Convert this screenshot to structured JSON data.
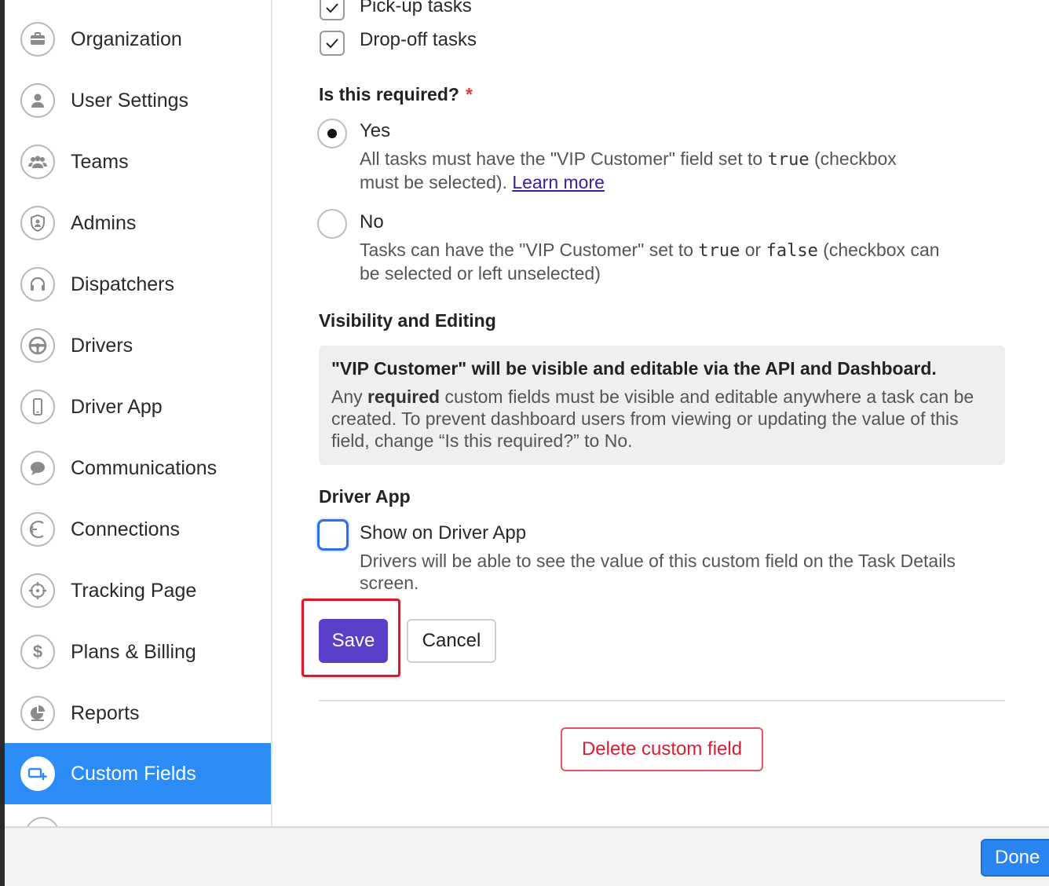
{
  "sidebar": {
    "items": [
      {
        "label": "Organization",
        "icon": "briefcase-icon"
      },
      {
        "label": "User Settings",
        "icon": "user-icon"
      },
      {
        "label": "Teams",
        "icon": "team-icon"
      },
      {
        "label": "Admins",
        "icon": "shield-user-icon"
      },
      {
        "label": "Dispatchers",
        "icon": "headset-icon"
      },
      {
        "label": "Drivers",
        "icon": "steering-wheel-icon"
      },
      {
        "label": "Driver App",
        "icon": "phone-icon"
      },
      {
        "label": "Communications",
        "icon": "chat-bubble-icon"
      },
      {
        "label": "Connections",
        "icon": "connection-icon"
      },
      {
        "label": "Tracking Page",
        "icon": "crosshair-icon"
      },
      {
        "label": "Plans & Billing",
        "icon": "dollar-icon"
      },
      {
        "label": "Reports",
        "icon": "pie-chart-icon"
      },
      {
        "label": "Custom Fields",
        "icon": "custom-field-icon",
        "active": true
      }
    ]
  },
  "task_types": {
    "pickup_label": "Pick-up tasks",
    "dropoff_label": "Drop-off tasks"
  },
  "required": {
    "heading": "Is this required?",
    "star": "*",
    "yes": {
      "label": "Yes",
      "desc_1": "All tasks must have the \"VIP Customer\" field set to ",
      "code": "true",
      "desc_2": " (checkbox",
      "desc_3": "must be selected). ",
      "link": "Learn more"
    },
    "no": {
      "label": "No",
      "desc_1": "Tasks can have the \"VIP Customer\" set to ",
      "code_true": "true",
      "desc_or": " or ",
      "code_false": "false",
      "desc_2": " (checkbox can",
      "desc_3": "be selected or left unselected)"
    }
  },
  "visibility": {
    "heading": "Visibility and Editing",
    "title": "\"VIP Customer\" will be visible and editable via the API and Dashboard.",
    "body_1": "Any ",
    "body_bold": "required",
    "body_2": " custom fields must be visible and editable anywhere a task can be created. To prevent dashboard users from viewing or updating the value of this field, change “Is this required?” to No."
  },
  "driver_app": {
    "heading": "Driver App",
    "checkbox_label": "Show on Driver App",
    "desc": "Drivers will be able to see the value of this custom field on the Task Details screen."
  },
  "actions": {
    "save": "Save",
    "cancel": "Cancel",
    "delete": "Delete custom field",
    "done": "Done"
  },
  "colors": {
    "active_nav": "#2b8cf7",
    "save_button": "#5b3fc9",
    "delete_text": "#d81e33",
    "highlight": "#e0162b",
    "done_button": "#2a85f0"
  }
}
